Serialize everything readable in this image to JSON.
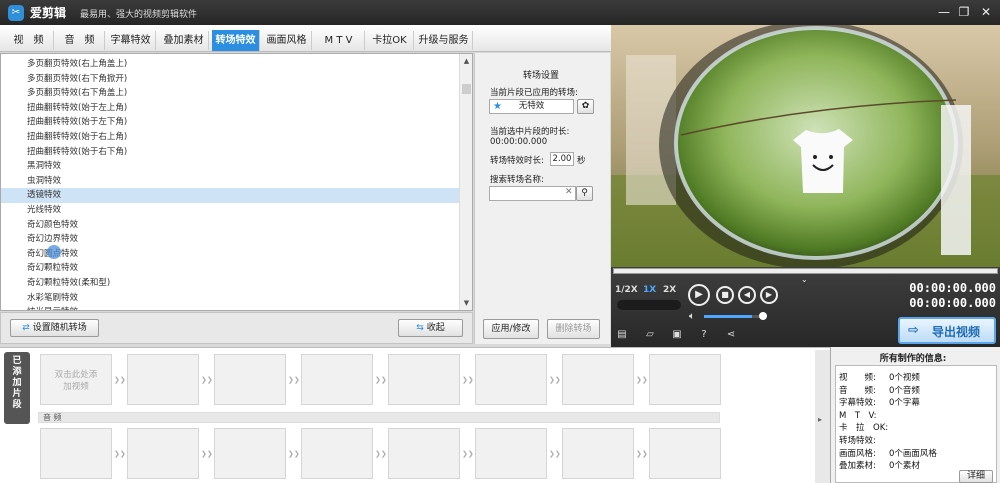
{
  "window": {
    "app_name": "爱剪辑",
    "slogan": "最易用、强大的视频剪辑软件",
    "minimize": "—",
    "restore": "❐",
    "close": "✕"
  },
  "tabs": [
    {
      "label": "视　频"
    },
    {
      "label": "音　频"
    },
    {
      "label": "字幕特效"
    },
    {
      "label": "叠加素材"
    },
    {
      "label": "转场特效",
      "active": true
    },
    {
      "label": "画面风格"
    },
    {
      "label": "M T V"
    },
    {
      "label": "卡拉OK"
    },
    {
      "label": "升级与服务"
    }
  ],
  "effects": [
    "多页翻页特效(右上角盖上)",
    "多页翻页特效(右下角掀开)",
    "多页翻页特效(右下角盖上)",
    "扭曲翻转特效(始于左上角)",
    "扭曲翻转特效(始于左下角)",
    "扭曲翻转特效(始于右上角)",
    "扭曲翻转特效(始于右下角)",
    "黑洞特效",
    "虫洞特效",
    "透镜特效",
    "光线特效",
    "奇幻颜色特效",
    "奇幻边界特效",
    "奇幻圆点特效",
    "奇幻颗粒特效",
    "奇幻颗粒特效(柔和型)",
    "水彩笔刷特效",
    "炫光显示特效"
  ],
  "selected_index": 9,
  "list_buttons": {
    "random": "设置随机转场",
    "collapse": "收起"
  },
  "settings": {
    "title": "转场设置",
    "applied_label": "当前片段已应用的转场:",
    "applied_value": "无特效",
    "duration_label": "当前选中片段的时长:",
    "duration_value": "00:00:00.000",
    "effect_duration_label": "转场特效时长:",
    "effect_duration_value": "2.00",
    "seconds_unit": "秒",
    "search_label": "搜索转场名称:",
    "search_value": "",
    "apply_button": "应用/修改",
    "delete_button": "删除转场"
  },
  "player": {
    "speeds": [
      "1/2X",
      "1X",
      "2X"
    ],
    "time_current": "00:00:00.000",
    "time_total": "00:00:00.000",
    "volume": 0.8,
    "export_label": "导出视频"
  },
  "timeline": {
    "video_label": "已添加片段",
    "add_clip": "双击此处添加视频",
    "audio_label": "音 频"
  },
  "info": {
    "title": "所有制作的信息:",
    "rows": [
      {
        "key": "视　　频:",
        "value": "0个视频"
      },
      {
        "key": "音　　频:",
        "value": "0个音频"
      },
      {
        "key": "字幕特效:",
        "value": "0个字幕"
      },
      {
        "key": "M　T　V:",
        "value": ""
      },
      {
        "key": "卡　拉　OK:",
        "value": ""
      },
      {
        "key": "转场特效:",
        "value": ""
      },
      {
        "key": "画面风格:",
        "value": "0个画面风格"
      },
      {
        "key": "叠加素材:",
        "value": "0个素材"
      }
    ],
    "detail_button": "详细"
  },
  "colors": {
    "accent": "#2c8ee0",
    "titlebar": "#2b2b2b",
    "selection": "#cfe3f7"
  }
}
